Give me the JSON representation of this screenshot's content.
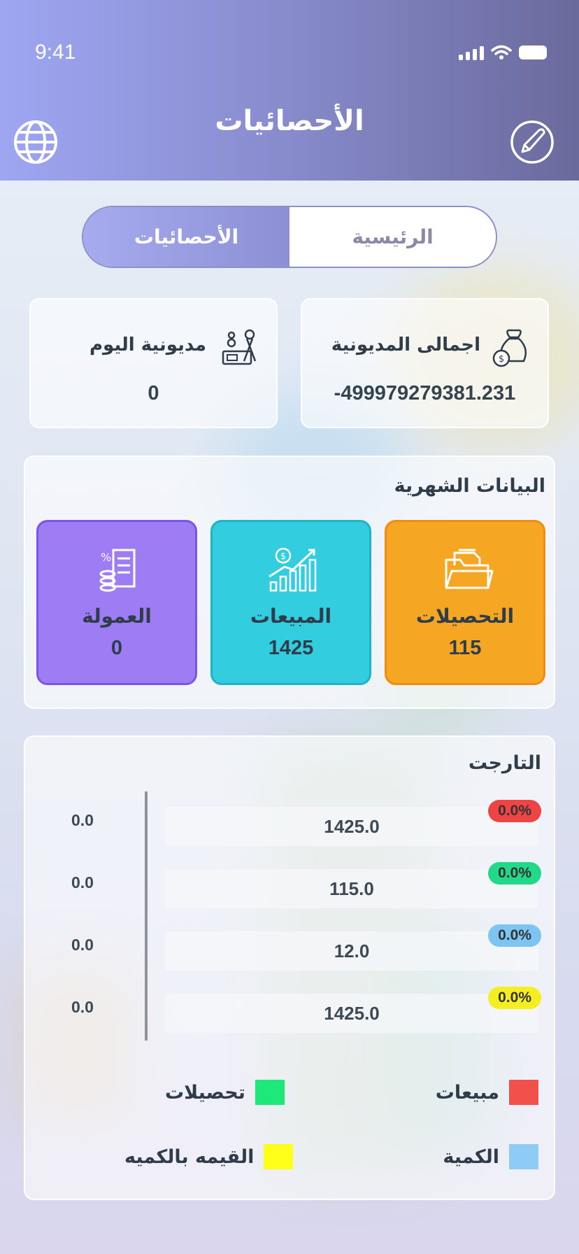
{
  "status_bar": {
    "time": "9:41"
  },
  "header": {
    "title": "الأحصائيات"
  },
  "tabs": {
    "main": "الرئيسية",
    "stats": "الأحصائيات"
  },
  "debt": {
    "total_label": "اجمالى المديونية",
    "total_value": "-499979279381.231",
    "today_label": "مديونية اليوم",
    "today_value": "0"
  },
  "monthly": {
    "title": "البيانات الشهرية",
    "tiles": [
      {
        "label": "التحصيلات",
        "value": "115",
        "color": "#f5a623"
      },
      {
        "label": "المبيعات",
        "value": "1425",
        "color": "#2ec8dc"
      },
      {
        "label": "العمولة",
        "value": "0",
        "color": "#8f6ff2"
      }
    ]
  },
  "target": {
    "title": "التارجت",
    "rows": [
      {
        "value": "1425.0",
        "percent": "0.0%",
        "left": "0.0",
        "color": "#ef4444"
      },
      {
        "value": "115.0",
        "percent": "0.0%",
        "left": "0.0",
        "color": "#22d889"
      },
      {
        "value": "12.0",
        "percent": "0.0%",
        "left": "0.0",
        "color": "#7cc4f2"
      },
      {
        "value": "1425.0",
        "percent": "0.0%",
        "left": "0.0",
        "color": "#f5ee22"
      }
    ],
    "legend": [
      {
        "label": "مبيعات",
        "color": "#f2504a"
      },
      {
        "label": "تحصيلات",
        "color": "#1ee87a"
      },
      {
        "label": "الكمية",
        "color": "#8ecbf5"
      },
      {
        "label": "القيمه بالكميه",
        "color": "#ffff1a"
      }
    ]
  }
}
